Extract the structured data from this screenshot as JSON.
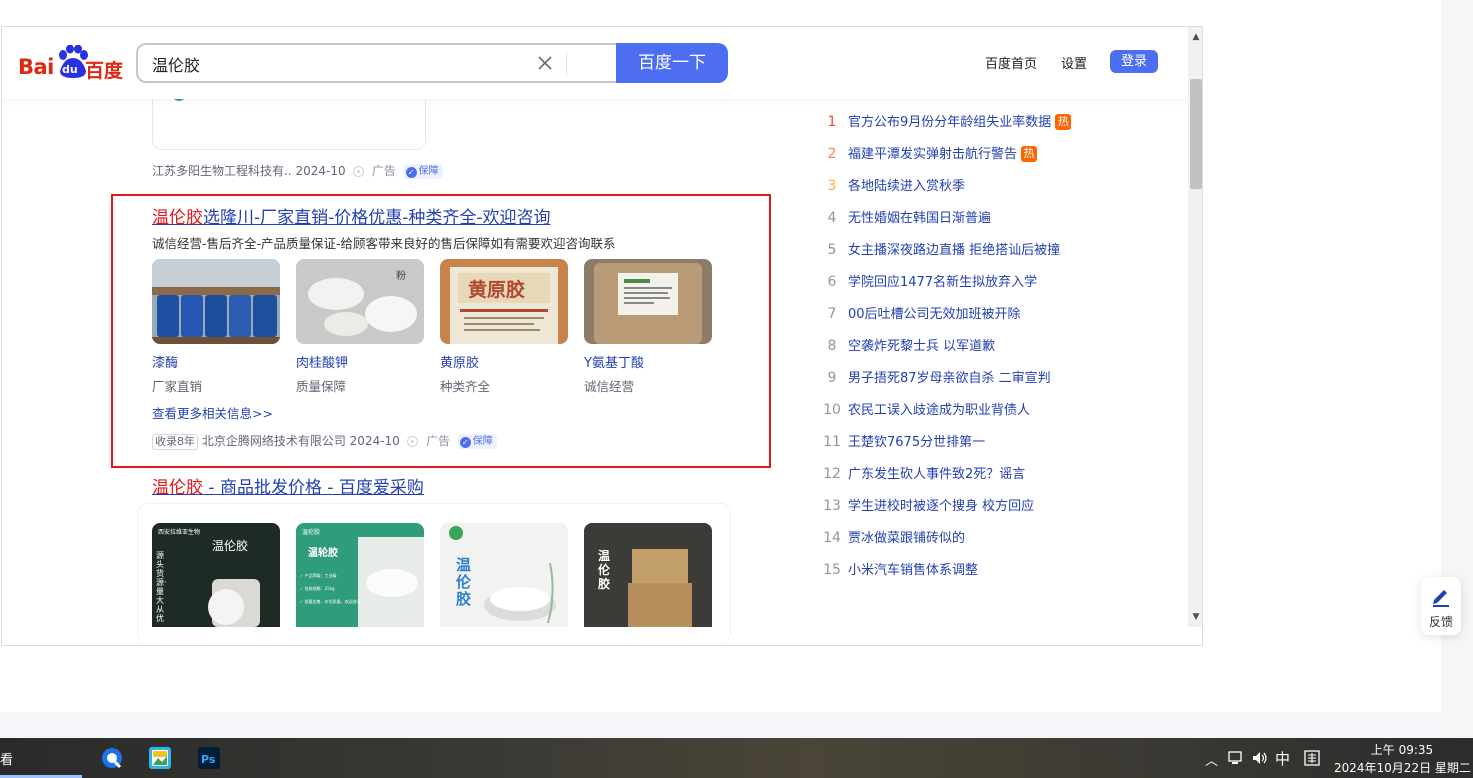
{
  "header": {
    "logo_bai": "Bai",
    "logo_du": "du",
    "logo_cn": "百度",
    "query": "温伦胶",
    "search_button": "百度一下",
    "links": [
      "百度首页",
      "设置"
    ],
    "login": "登录"
  },
  "results": {
    "prev_meta": {
      "company": "江苏多阳生物工程科技有..",
      "date": "2024-10",
      "ad": "广告",
      "badge": "保障"
    },
    "ad": {
      "title_hl": "温伦胶",
      "title_rest": "选隆川-厂家直销-价格优惠-种类齐全-欢迎咨询",
      "desc": "诚信经营-售后齐全-产品质量保证-给顾客带来良好的售后保障如有需要欢迎咨询联系",
      "products": [
        {
          "name": "漆酶",
          "sub": "厂家直销"
        },
        {
          "name": "肉桂酸钾",
          "sub": "质量保障"
        },
        {
          "name": "黄原胶",
          "sub": "种类齐全"
        },
        {
          "name": "Y氨基丁酸",
          "sub": "诚信经营"
        }
      ],
      "more": "查看更多相关信息>>",
      "meta": {
        "tag": "收录8年",
        "company": "北京企腾网络技术有限公司",
        "date": "2024-10",
        "ad": "广告",
        "badge": "保障"
      }
    },
    "second": {
      "title_hl": "温伦胶",
      "title_rest": " - 商品批发价格 - 百度爱采购",
      "thumb_texts": [
        "温伦胶",
        "温轮胶",
        "温伦胶",
        "温伦胶"
      ],
      "thumb1_small": "西安拉维亚生物",
      "thumb1_side": "源头货源·量大从优",
      "thumb2_small": "温伦胶",
      "thumb2_lines": [
        "✓ 产品等级：工业级",
        "✓ 包装规格：25kg",
        "✓ 批量出售，价优质量，欢迎咨询"
      ]
    }
  },
  "hot": [
    {
      "n": "1",
      "t": "官方公布9月份分年龄组失业率数据",
      "badge": "热",
      "color": "#f54545"
    },
    {
      "n": "2",
      "t": "福建平潭发实弹射击航行警告",
      "badge": "热",
      "color": "#ff8547"
    },
    {
      "n": "3",
      "t": "各地陆续进入赏秋季",
      "badge": "",
      "color": "#ffac38"
    },
    {
      "n": "4",
      "t": "无性婚姻在韩国日渐普遍",
      "badge": "",
      "color": ""
    },
    {
      "n": "5",
      "t": "女主播深夜路边直播 拒绝搭讪后被撞",
      "badge": "",
      "color": ""
    },
    {
      "n": "6",
      "t": "学院回应1477名新生拟放弃入学",
      "badge": "",
      "color": ""
    },
    {
      "n": "7",
      "t": "00后吐槽公司无效加班被开除",
      "badge": "",
      "color": ""
    },
    {
      "n": "8",
      "t": "空袭炸死黎士兵 以军道歉",
      "badge": "",
      "color": ""
    },
    {
      "n": "9",
      "t": "男子捂死87岁母亲欲自杀 二审宣判",
      "badge": "",
      "color": ""
    },
    {
      "n": "10",
      "t": "农民工误入歧途成为职业背债人",
      "badge": "",
      "color": ""
    },
    {
      "n": "11",
      "t": "王楚钦7675分世排第一",
      "badge": "",
      "color": ""
    },
    {
      "n": "12",
      "t": "广东发生砍人事件致2死？谣言",
      "badge": "",
      "color": ""
    },
    {
      "n": "13",
      "t": "学生进校时被逐个搜身 校方回应",
      "badge": "",
      "color": ""
    },
    {
      "n": "14",
      "t": "贾冰做菜跟铺砖似的",
      "badge": "",
      "color": ""
    },
    {
      "n": "15",
      "t": "小米汽车销售体系调整",
      "badge": "",
      "color": ""
    }
  ],
  "feedback": {
    "label": "反馈",
    "icon": "pen-icon"
  },
  "taskbar": {
    "left_text": "看",
    "apps": [
      "browser-icon",
      "image-viewer-icon",
      "photoshop-icon"
    ],
    "ps_label": "Ps",
    "ime": "中",
    "time": "上午 09:35",
    "date": "2024年10月22日 星期二"
  },
  "colors": {
    "accent": "#4e6ef2",
    "link": "#2440b3",
    "highlight": "#e4161b",
    "hot_badge": "#ff6600"
  }
}
